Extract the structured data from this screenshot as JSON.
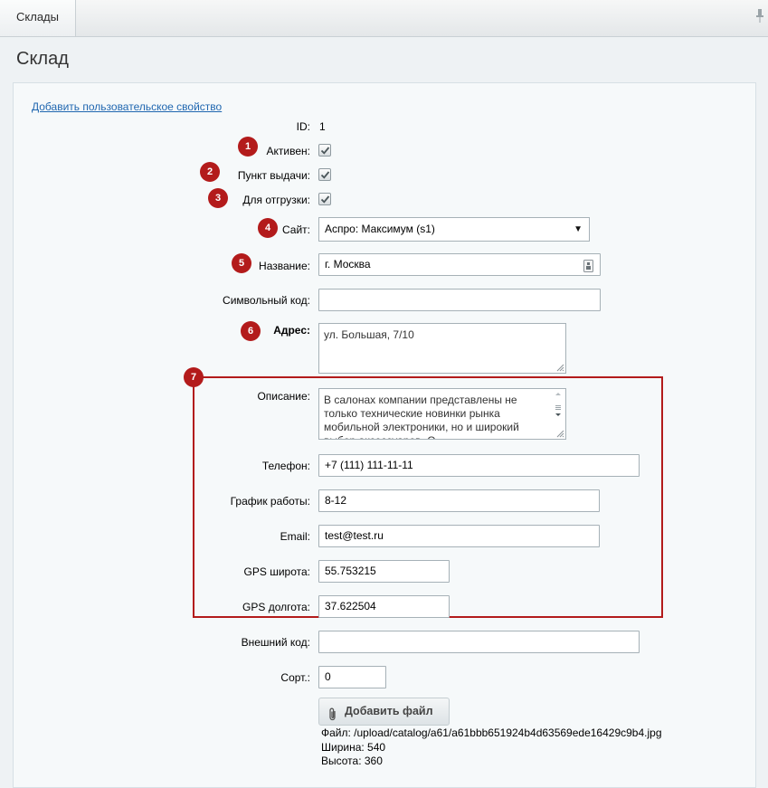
{
  "tab": {
    "label": "Склады"
  },
  "page": {
    "title": "Склад"
  },
  "add_property_link": "Добавить пользовательское свойство",
  "fields": {
    "id": {
      "label": "ID:",
      "value": "1"
    },
    "active": {
      "label": "Активен:",
      "checked": true
    },
    "pickup": {
      "label": "Пункт выдачи:",
      "checked": true
    },
    "shipping": {
      "label": "Для отгрузки:",
      "checked": true
    },
    "site": {
      "label": "Сайт:",
      "value": "Аспро: Максимум (s1)"
    },
    "name": {
      "label": "Название:",
      "value": "г. Москва"
    },
    "code": {
      "label": "Символьный код:",
      "value": ""
    },
    "address": {
      "label": "Адрес:",
      "value": "ул. Большая, 7/10"
    },
    "description": {
      "label": "Описание:",
      "value": "В салонах компании представлены не только технические новинки рынка мобильной электроники, но и широкий выбор аксессуаров. О"
    },
    "phone": {
      "label": "Телефон:",
      "value": "+7 (111) 111-11-11"
    },
    "schedule": {
      "label": "График работы:",
      "value": "8-12"
    },
    "email": {
      "label": "Email:",
      "value": "test@test.ru"
    },
    "gps_lat": {
      "label": "GPS широта:",
      "value": "55.753215"
    },
    "gps_lon": {
      "label": "GPS долгота:",
      "value": "37.622504"
    },
    "xml_id": {
      "label": "Внешний код:",
      "value": ""
    },
    "sort": {
      "label": "Сорт.:",
      "value": "0"
    }
  },
  "add_file_button": "Добавить файл",
  "file_info": {
    "path": "Файл: /upload/catalog/a61/a61bbb651924b4d63569ede16429c9b4.jpg",
    "width": "Ширина: 540",
    "height": "Высота: 360"
  },
  "badges": [
    "1",
    "2",
    "3",
    "4",
    "5",
    "6",
    "7"
  ],
  "colors": {
    "badge": "#b31b1b",
    "link": "#2067b0",
    "highlight": "#b31b1b"
  }
}
